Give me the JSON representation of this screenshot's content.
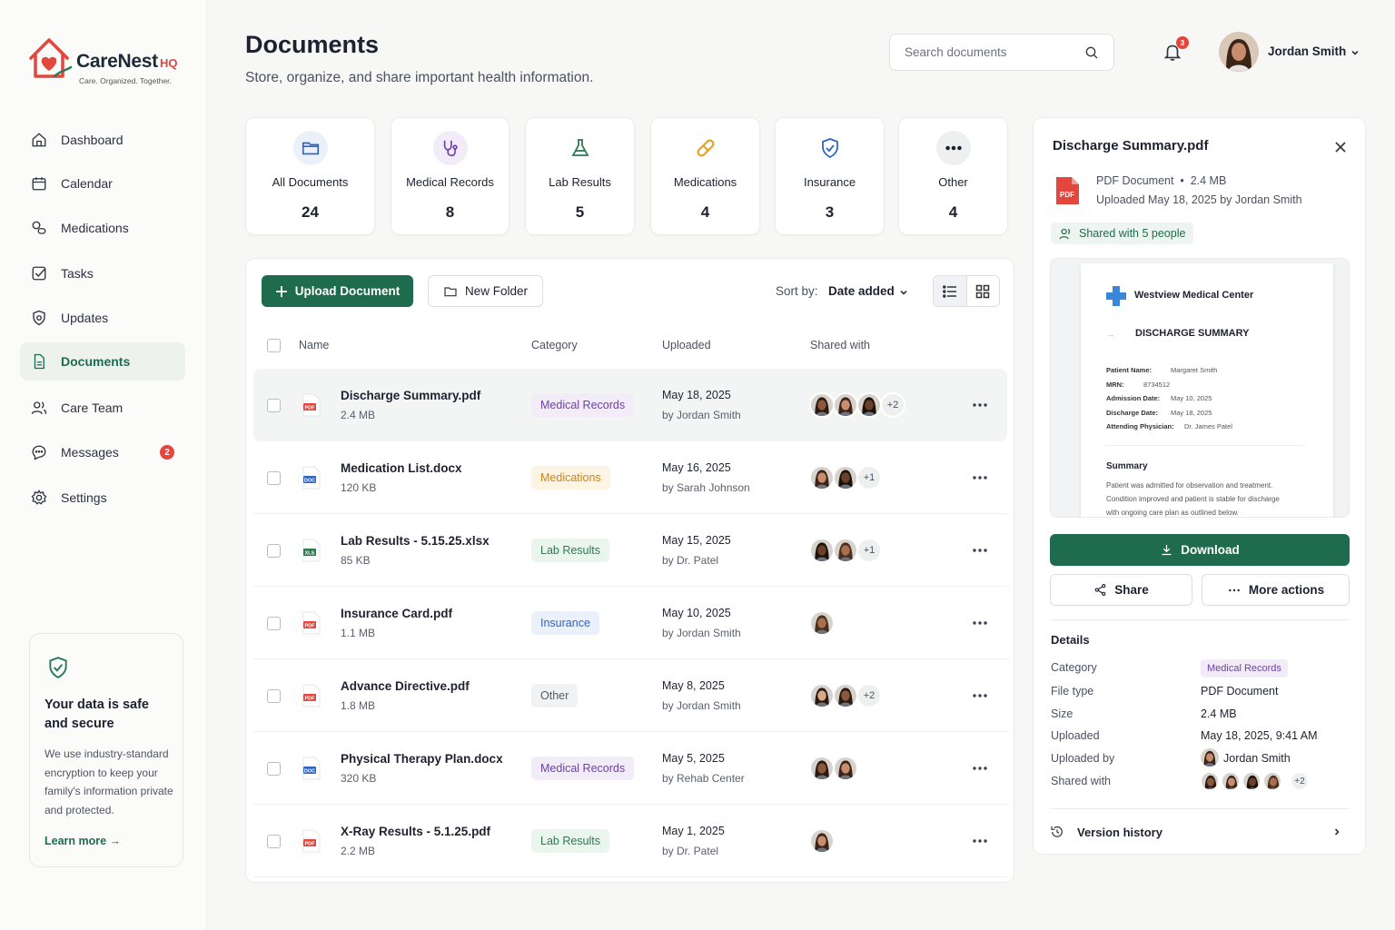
{
  "brand": {
    "name": "CareNest",
    "suffix": "HQ",
    "tagline": "Care. Organized. Together.",
    "accent": "#1f6b4e",
    "logo_color": "#e2463c"
  },
  "sidebar": {
    "items": [
      {
        "label": "Dashboard",
        "icon": "home-icon"
      },
      {
        "label": "Calendar",
        "icon": "calendar-icon"
      },
      {
        "label": "Medications",
        "icon": "pill-icon"
      },
      {
        "label": "Tasks",
        "icon": "checkbox-icon"
      },
      {
        "label": "Updates",
        "icon": "shield-check-icon"
      },
      {
        "label": "Documents",
        "icon": "document-icon",
        "active": true
      },
      {
        "label": "Care Team",
        "icon": "users-icon"
      },
      {
        "label": "Messages",
        "icon": "chat-icon",
        "badge": "2"
      },
      {
        "label": "Settings",
        "icon": "gear-icon"
      }
    ],
    "safe_card": {
      "title": "Your data is safe and secure",
      "text": "We use industry-standard encryption to keep your family's information private and protected.",
      "link": "Learn more →"
    }
  },
  "header": {
    "title": "Documents",
    "subtitle": "Store, organize, and share important health information.",
    "search_placeholder": "Search documents",
    "notification_count": "3",
    "user_name": "Jordan Smith"
  },
  "categories": [
    {
      "label": "All Documents",
      "count": "24",
      "icon": "folder-icon",
      "color": "#2f64c2",
      "bg": "#eaf1fb"
    },
    {
      "label": "Medical Records",
      "count": "8",
      "icon": "stethoscope-icon",
      "color": "#6e3fa8",
      "bg": "#f1ecf8"
    },
    {
      "label": "Lab Results",
      "count": "5",
      "icon": "flask-icon",
      "color": "#2c7a4f",
      "bg": "#ffffff"
    },
    {
      "label": "Medications",
      "count": "4",
      "icon": "pill-icon",
      "color": "#e8a21a",
      "bg": "#ffffff"
    },
    {
      "label": "Insurance",
      "count": "3",
      "icon": "shield-icon",
      "color": "#2f64c2",
      "bg": "#ffffff"
    },
    {
      "label": "Other",
      "count": "4",
      "icon": "dots-icon",
      "color": "#1d2230",
      "bg": "#eef0f0"
    }
  ],
  "toolbar": {
    "upload_label": "Upload Document",
    "folder_label": "New Folder",
    "sort_label": "Sort by:",
    "sort_value": "Date added"
  },
  "table": {
    "headers": {
      "name": "Name",
      "category": "Category",
      "uploaded": "Uploaded",
      "shared": "Shared with"
    },
    "rows": [
      {
        "name": "Discharge Summary.pdf",
        "size": "2.4 MB",
        "type": "PDF",
        "category": "Medical Records",
        "date": "May 18, 2025",
        "by": "by Jordan Smith",
        "avatars": 3,
        "more": "+2"
      },
      {
        "name": "Medication List.docx",
        "size": "120 KB",
        "type": "DOC",
        "category": "Medications",
        "date": "May 16, 2025",
        "by": "by Sarah Johnson",
        "avatars": 2,
        "more": "+1"
      },
      {
        "name": "Lab Results - 5.15.25.xlsx",
        "size": "85 KB",
        "type": "XLS",
        "category": "Lab Results",
        "date": "May 15, 2025",
        "by": "by Dr. Patel",
        "avatars": 2,
        "more": "+1"
      },
      {
        "name": "Insurance Card.pdf",
        "size": "1.1 MB",
        "type": "PDF",
        "category": "Insurance",
        "date": "May 10, 2025",
        "by": "by Jordan Smith",
        "avatars": 1,
        "more": ""
      },
      {
        "name": "Advance Directive.pdf",
        "size": "1.8 MB",
        "type": "PDF",
        "category": "Other",
        "date": "May 8, 2025",
        "by": "by Jordan Smith",
        "avatars": 2,
        "more": "+2"
      },
      {
        "name": "Physical Therapy Plan.docx",
        "size": "320 KB",
        "type": "DOC",
        "category": "Medical Records",
        "date": "May 5, 2025",
        "by": "by Rehab Center",
        "avatars": 2,
        "more": ""
      },
      {
        "name": "X-Ray Results - 5.1.25.pdf",
        "size": "2.2 MB",
        "type": "PDF",
        "category": "Lab Results",
        "date": "May 1, 2025",
        "by": "by Dr. Patel",
        "avatars": 1,
        "more": ""
      }
    ]
  },
  "detail": {
    "title": "Discharge Summary.pdf",
    "meta1": "PDF Document  •  2.4 MB",
    "meta2": "Uploaded May 18, 2025 by Jordan Smith",
    "shared_badge": "Shared with 5 people",
    "preview": {
      "org": "Westview Medical Center",
      "heading": "DISCHARGE SUMMARY",
      "fields": [
        {
          "k": "Patient Name:",
          "v": "Margaret Smith"
        },
        {
          "k": "MRN:",
          "v": "8734512"
        },
        {
          "k": "Admission Date:",
          "v": "May 10, 2025"
        },
        {
          "k": "Discharge Date:",
          "v": "May 18, 2025"
        },
        {
          "k": "Attending Physician:",
          "v": "Dr. James Patel"
        }
      ],
      "summary_title": "Summary",
      "summary_lines": [
        "Patient was admitted for observation and treatment.",
        "Condition improved and patient is stable for discharge",
        "with ongoing care plan as outlined below."
      ]
    },
    "download_label": "Download",
    "share_label": "Share",
    "more_label": "More actions",
    "details_heading": "Details",
    "details": [
      {
        "k": "Category",
        "v": "Medical Records"
      },
      {
        "k": "File type",
        "v": "PDF Document"
      },
      {
        "k": "Size",
        "v": "2.4 MB"
      },
      {
        "k": "Uploaded",
        "v": "May 18, 2025, 9:41 AM"
      },
      {
        "k": "Uploaded by",
        "v": "Jordan Smith"
      },
      {
        "k": "Shared with",
        "v": "+2"
      }
    ],
    "version_history": "Version history"
  }
}
